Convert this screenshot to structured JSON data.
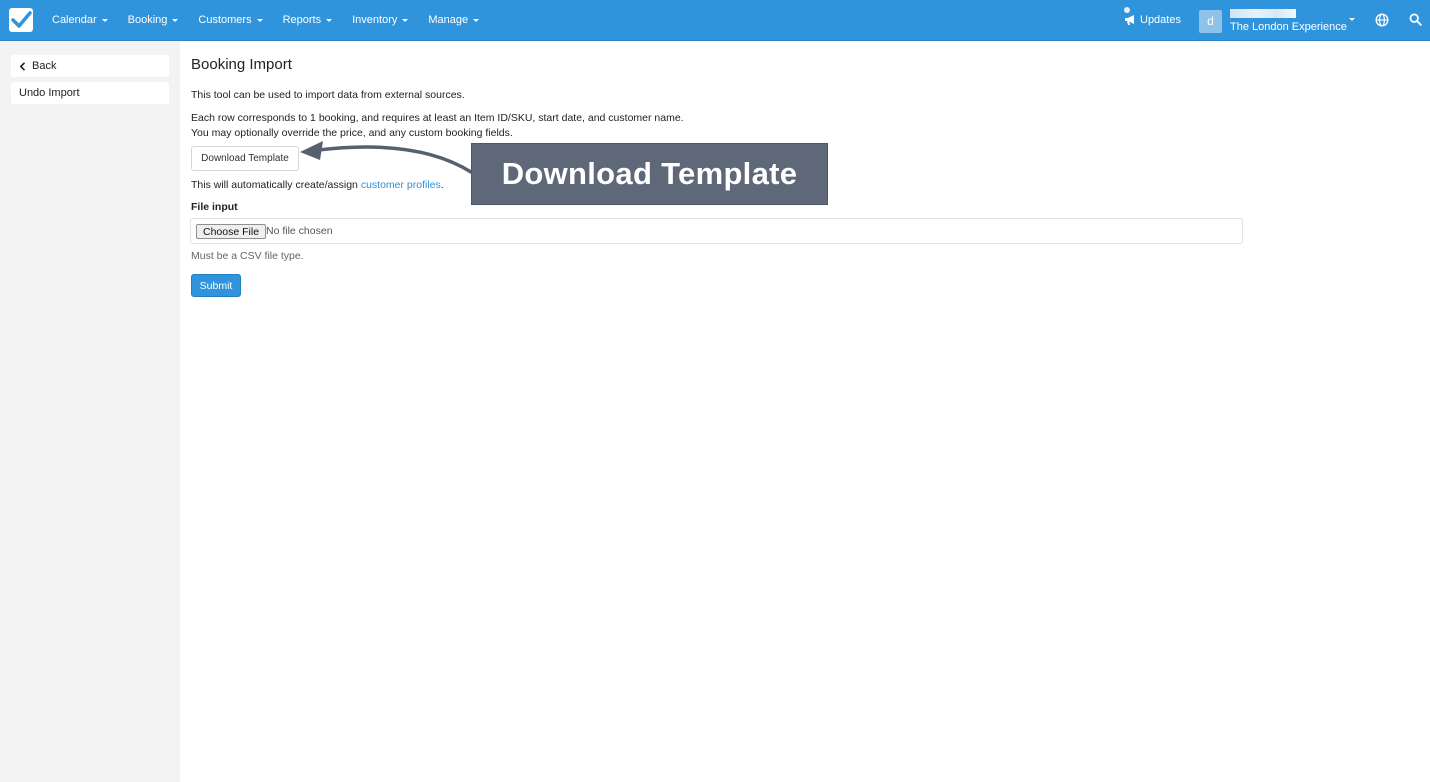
{
  "nav": {
    "items": [
      {
        "label": "Calendar"
      },
      {
        "label": "Booking"
      },
      {
        "label": "Customers"
      },
      {
        "label": "Reports"
      },
      {
        "label": "Inventory"
      },
      {
        "label": "Manage"
      }
    ],
    "updates_label": "Updates",
    "account_initial": "d",
    "account_name": "The London Experience"
  },
  "sidebar": {
    "back_label": "Back",
    "undo_label": "Undo Import"
  },
  "main": {
    "title": "Booking Import",
    "intro": "This tool can be used to import data from external sources.",
    "row_desc_1": "Each row corresponds to 1 booking, and requires at least an Item ID/SKU, start date, and customer name.",
    "row_desc_2": "You may optionally override the price, and any custom booking fields.",
    "download_label": "Download Template",
    "auto_prefix": "This will automatically create/assign ",
    "auto_link": "customer profiles",
    "auto_suffix": ".",
    "file_label": "File input",
    "choose_label": "Choose File",
    "no_file_label": "No file chosen",
    "help_text": "Must be a CSV file type.",
    "submit_label": "Submit"
  },
  "annotation": {
    "callout_text": "Download Template",
    "callout_color": "#5e6878"
  },
  "colors": {
    "primary": "#2f94dc",
    "link": "#2f8fd8"
  }
}
